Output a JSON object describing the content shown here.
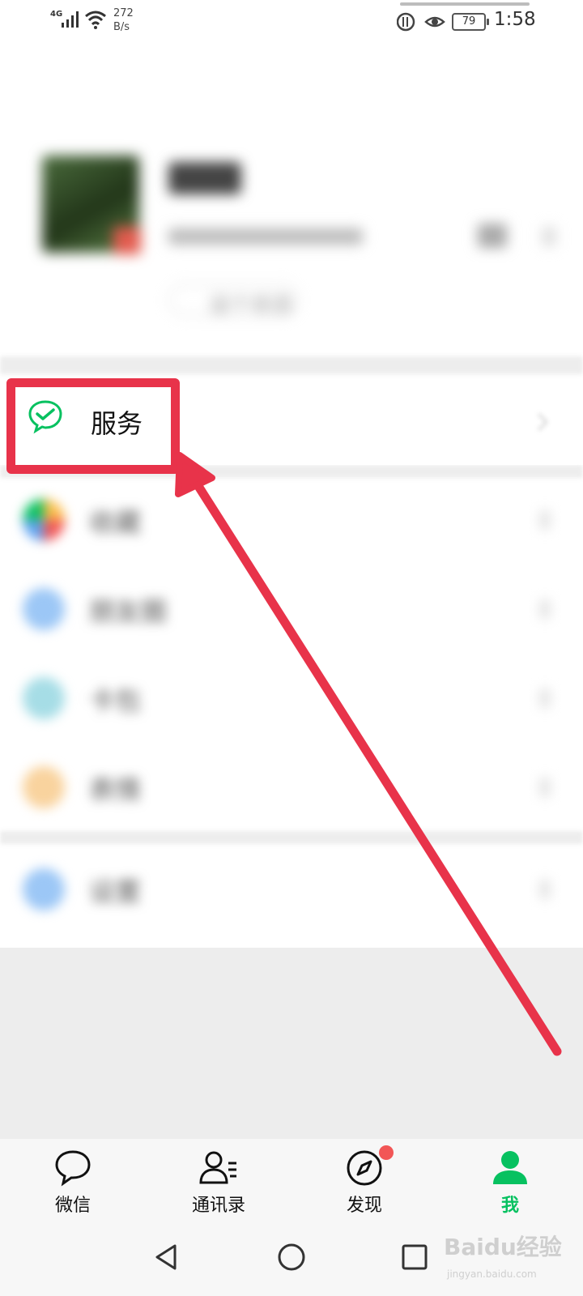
{
  "status_bar": {
    "network": "4G",
    "speed_value": "272",
    "speed_unit": "B/s",
    "battery": "79",
    "time": "1:58"
  },
  "profile": {
    "status_button": "设个状态"
  },
  "service": {
    "label": "服务",
    "icon": "wechat-pay-check-icon"
  },
  "menu_items": [
    {
      "label": "收藏",
      "icon": "favorites-icon",
      "color": "#fbbd4a"
    },
    {
      "label": "朋友圈",
      "icon": "moments-icon",
      "color": "#5fa3f0"
    },
    {
      "label": "卡包",
      "icon": "cards-icon",
      "color": "#66c7d6"
    },
    {
      "label": "表情",
      "icon": "emoji-icon",
      "color": "#f6b25c"
    },
    {
      "label": "设置",
      "icon": "settings-icon",
      "color": "#5fa3f0"
    }
  ],
  "tabs": [
    {
      "label": "微信",
      "icon": "chat-bubble-icon"
    },
    {
      "label": "通讯录",
      "icon": "contacts-icon"
    },
    {
      "label": "发现",
      "icon": "compass-icon"
    },
    {
      "label": "我",
      "icon": "me-person-icon"
    }
  ],
  "colors": {
    "accent": "#07c160",
    "annotation": "#e8334a",
    "badge": "#f25656"
  },
  "watermark": {
    "brand": "Baidu经验",
    "url": "jingyan.baidu.com"
  }
}
